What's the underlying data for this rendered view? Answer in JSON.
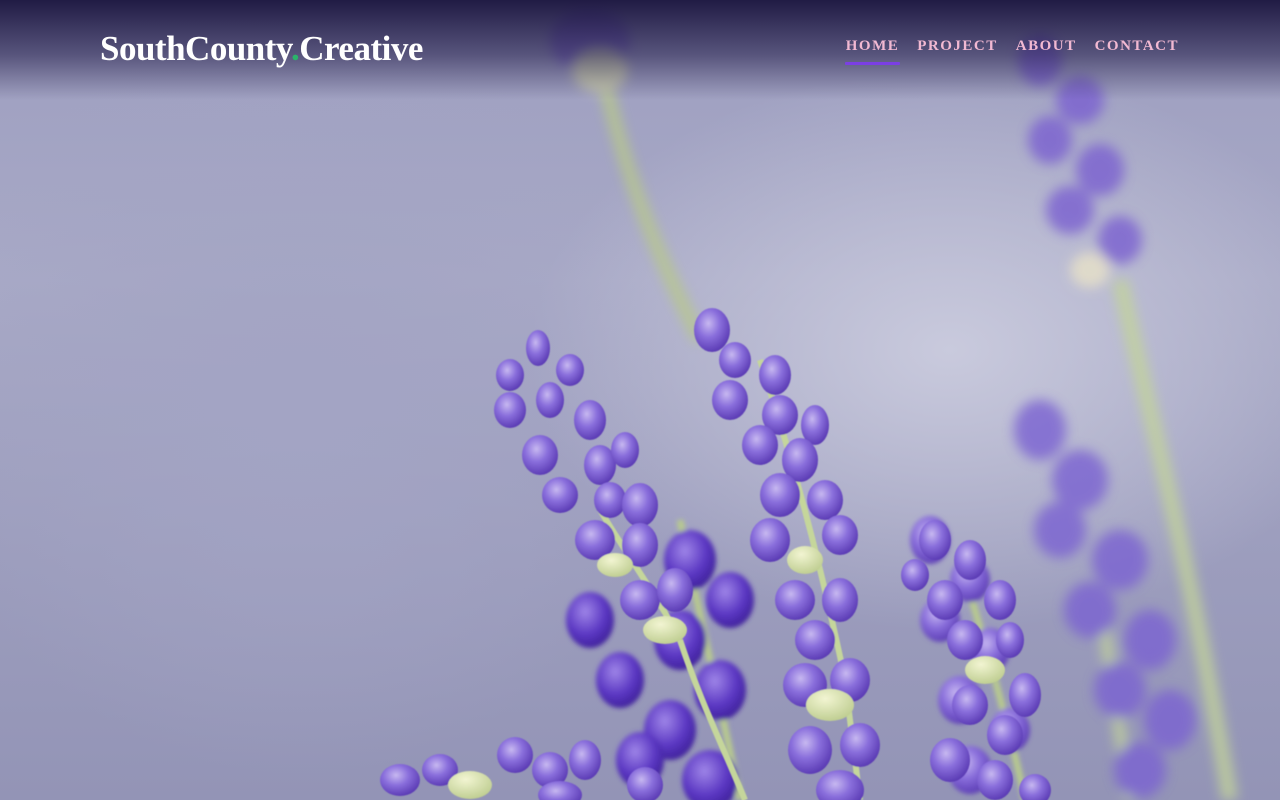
{
  "header": {
    "logo": {
      "part1": "SouthCounty",
      "dot": ".",
      "part2": "Creative"
    },
    "nav": [
      {
        "label": "HOME",
        "active": true
      },
      {
        "label": "PROJECT",
        "active": false
      },
      {
        "label": "ABOUT",
        "active": false
      },
      {
        "label": "CONTACT",
        "active": false
      }
    ]
  },
  "hero": {
    "image_subject": "lavender-flowers"
  },
  "colors": {
    "nav_text": "#f2b9d2",
    "nav_active_underline": "#7b3fe4",
    "logo_dot": "#2bb36a",
    "logo_text": "#ffffff",
    "header_bg": "#1a143e"
  }
}
